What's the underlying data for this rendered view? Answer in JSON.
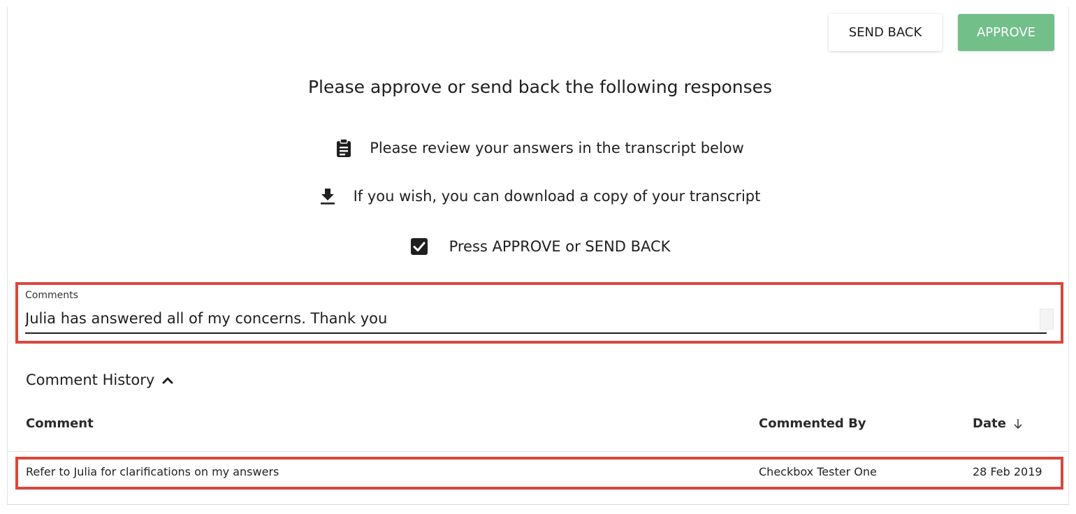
{
  "toolbar": {
    "send_back_label": "SEND BACK",
    "approve_label": "APPROVE"
  },
  "heading": "Please approve or send back the following responses",
  "instructions": [
    {
      "icon": "clipboard-icon",
      "text": "Please review your answers in the transcript below"
    },
    {
      "icon": "download-icon",
      "text": "If you wish, you can download a copy of your transcript"
    },
    {
      "icon": "checkbox-checked-icon",
      "text": "Press APPROVE or SEND BACK"
    }
  ],
  "comments": {
    "label": "Comments",
    "value": "Julia has answered all of my concerns. Thank you"
  },
  "history": {
    "title": "Comment History",
    "expanded": true,
    "columns": {
      "comment": "Comment",
      "commented_by": "Commented By",
      "date": "Date"
    },
    "sort": {
      "column": "date",
      "direction": "descending"
    },
    "rows": [
      {
        "comment": "Refer to Julia for clarifications on my answers",
        "commented_by": "Checkbox Tester One",
        "date": "28 Feb 2019"
      }
    ]
  },
  "colors": {
    "approve": "#72bf8a",
    "highlight": "#d9473d"
  }
}
